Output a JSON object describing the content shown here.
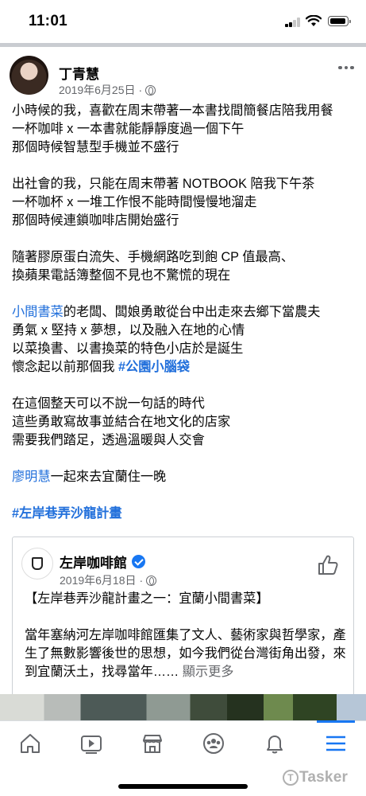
{
  "status_bar": {
    "time": "11:01"
  },
  "post": {
    "author": "丁青慧",
    "date": "2019年6月25日",
    "paragraphs": [
      {
        "lines": [
          "小時候的我，喜歡在周末帶著一本書找間簡餐店陪我用餐",
          "一杯咖啡 x 一本書就能靜靜度過一個下午",
          "那個時候智慧型手機並不盛行"
        ]
      },
      {
        "lines": [
          "出社會的我，只能在周末帶著 NOTBOOK 陪我下午茶",
          "一杯咖杯 x 一堆工作恨不能時間慢慢地溜走",
          "那個時候連鎖咖啡店開始盛行"
        ]
      },
      {
        "lines": [
          "隨著膠原蛋白流失、手機網路吃到飽 CP 值最高、",
          "換蘋果電話簿整個不見也不驚慌的現在"
        ]
      }
    ],
    "p4": {
      "link": "小間書菜",
      "line1_rest": "的老闆、闆娘勇敢從台中出走來去鄉下當農夫",
      "line2": "勇氣 x 堅持 x 夢想，以及融入在地的心情",
      "line3": "以菜換書、以書換菜的特色小店於是誕生",
      "line4_start": "懷念起以前那個我 ",
      "line4_hashtag": "#公園小腦袋"
    },
    "p5": [
      "在這個整天可以不說一句話的時代",
      "這些勇敢寫故事並結合在地文化的店家",
      "需要我們踏足，透過溫暖與人交會"
    ],
    "p6": {
      "link": "廖明慧",
      "rest": "一起來去宜蘭住一晚"
    },
    "p7_hashtag": "#左岸巷弄沙龍計畫"
  },
  "shared": {
    "page_name": "左岸咖啡館",
    "date": "2019年6月18日",
    "title": "【左岸巷弄沙龍計畫之一：宜蘭小間書菜】",
    "body": "當年塞納河左岸咖啡館匯集了文人、藝術家與哲學家，產生了無數影響後世的思想，如今我們從台灣街角出發，來到宜蘭沃土，找尋當年…… ",
    "see_more": "顯示更多"
  },
  "tab_bar": [
    "home",
    "watch",
    "marketplace",
    "groups",
    "notifications",
    "menu"
  ],
  "watermark": "Tasker",
  "colors": {
    "link": "#216fdb",
    "accent": "#1877f2",
    "meta": "#65676b"
  }
}
